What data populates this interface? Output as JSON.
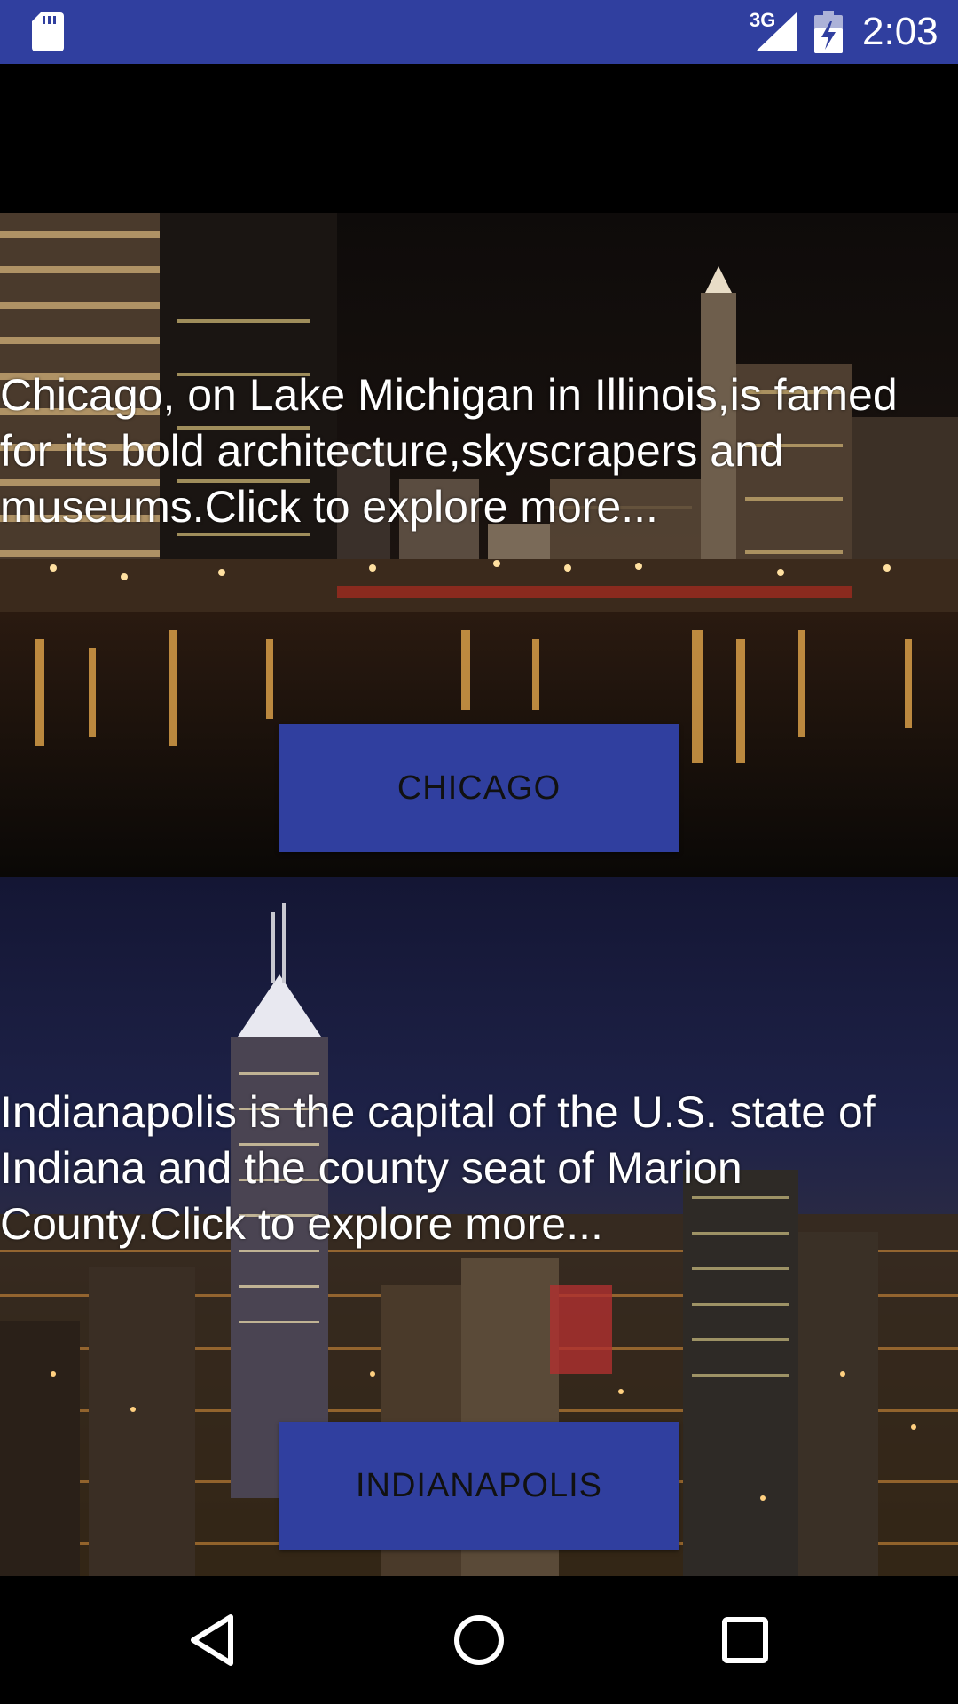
{
  "status_bar": {
    "network_type": "3G",
    "time": "2:03",
    "icons": [
      "sd-card-icon",
      "cell-signal-icon",
      "battery-charging-icon"
    ]
  },
  "cities": [
    {
      "name": "Chicago",
      "description": "Chicago, on Lake Michigan in Illinois,is famed for its bold architecture,skyscrapers and museums.Click to explore more...",
      "button_label": "CHICAGO"
    },
    {
      "name": "Indianapolis",
      "description": "Indianapolis is the capital of the U.S. state of Indiana and the county seat of Marion County.Click to explore more...",
      "button_label": "INDIANAPOLIS"
    }
  ],
  "nav_bar": {
    "icons": [
      "back-icon",
      "home-icon",
      "recents-icon"
    ]
  },
  "colors": {
    "primary": "#303f9f",
    "status_bar": "#303f9f",
    "text_on_image": "#ffffff",
    "button_text": "#111111"
  }
}
